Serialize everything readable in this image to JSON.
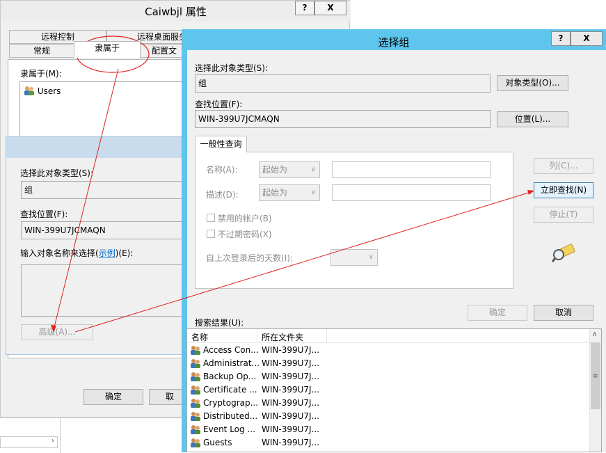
{
  "props_window": {
    "title": "Caiwbjl 属性",
    "help_btn": "?",
    "close_btn": "X",
    "tabs_back": [
      "远程控制",
      "远程桌面服务"
    ],
    "tabs_front": [
      "常规",
      "隶属于",
      "配置文"
    ],
    "member_of_label": "隶属于(M):",
    "members": [
      "Users"
    ],
    "ok": "确定",
    "cancel": "取"
  },
  "mid_dialog": {
    "object_type_label": "选择此对象类型(S):",
    "object_type_value": "组",
    "location_label": "查找位置(F):",
    "location_value": "WIN-399U7JCMAQN",
    "enter_names_label_pre": "输入对象名称来选择(",
    "example_link": "示例",
    "enter_names_label_post": ")(E):",
    "advanced": "高级(A)..."
  },
  "select_group": {
    "title": "选择组",
    "help_btn": "?",
    "close_btn": "X",
    "object_type_label": "选择此对象类型(S):",
    "object_type_value": "组",
    "object_types_btn": "对象类型(O)...",
    "location_label": "查找位置(F):",
    "location_value": "WIN-399U7JCMAQN",
    "locations_btn": "位置(L)...",
    "common_queries_tab": "一般性查询",
    "name_label": "名称(A):",
    "name_mode": "起始为",
    "desc_label": "描述(D):",
    "desc_mode": "起始为",
    "disabled_accounts": "禁用的帐户(B)",
    "non_expiring": "不过期密码(X)",
    "days_since_logon": "自上次登录后的天数(I):",
    "columns_btn": "列(C)...",
    "find_now_btn": "立即查找(N)",
    "stop_btn": "停止(T)",
    "ok": "确定",
    "cancel": "取消",
    "search_results_label": "搜索结果(U):",
    "col_name": "名称",
    "col_folder": "所在文件夹",
    "results": [
      {
        "name": "Access Con...",
        "folder": "WIN-399U7J..."
      },
      {
        "name": "Administrat...",
        "folder": "WIN-399U7J..."
      },
      {
        "name": "Backup Op...",
        "folder": "WIN-399U7J..."
      },
      {
        "name": "Certificate ...",
        "folder": "WIN-399U7J..."
      },
      {
        "name": "Cryptograp...",
        "folder": "WIN-399U7J..."
      },
      {
        "name": "Distributed...",
        "folder": "WIN-399U7J..."
      },
      {
        "name": "Event Log ...",
        "folder": "WIN-399U7J..."
      },
      {
        "name": "Guests",
        "folder": "WIN-399U7J..."
      }
    ]
  },
  "icons": {
    "user_group": "user-group-icon",
    "search": "magnifier-icon"
  },
  "annotation_color": "#e02020"
}
